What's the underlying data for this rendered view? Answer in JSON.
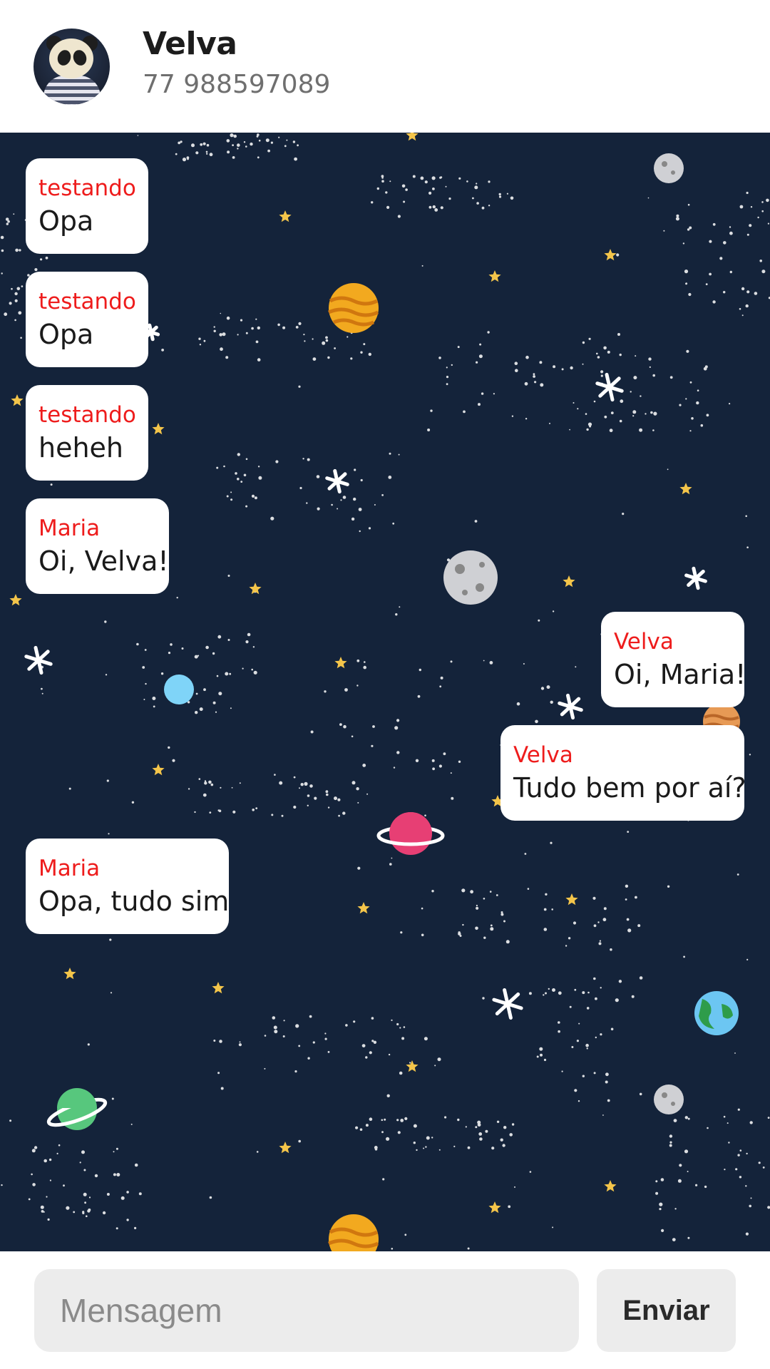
{
  "header": {
    "contact_name": "Velva",
    "contact_phone": "77 988597089",
    "avatar_icon": "panda-avatar"
  },
  "messages": [
    {
      "sender": "testando",
      "text": "Opa",
      "side": "left"
    },
    {
      "sender": "testando",
      "text": "Opa",
      "side": "left"
    },
    {
      "sender": "testando",
      "text": "heheh",
      "side": "left"
    },
    {
      "sender": "Maria",
      "text": "Oi, Velva!",
      "side": "left"
    },
    {
      "sender": "Velva",
      "text": "Oi, Maria!",
      "side": "right"
    },
    {
      "sender": "Velva",
      "text": "Tudo bem por aí?",
      "side": "right"
    },
    {
      "sender": "Maria",
      "text": "Opa, tudo sim",
      "side": "left"
    }
  ],
  "composer": {
    "placeholder": "Mensagem",
    "value": "",
    "send_label": "Enviar"
  },
  "colors": {
    "chat_background": "#14233a",
    "sender_name": "#ee1c1c",
    "bubble": "#ffffff",
    "input_background": "#ececec"
  }
}
